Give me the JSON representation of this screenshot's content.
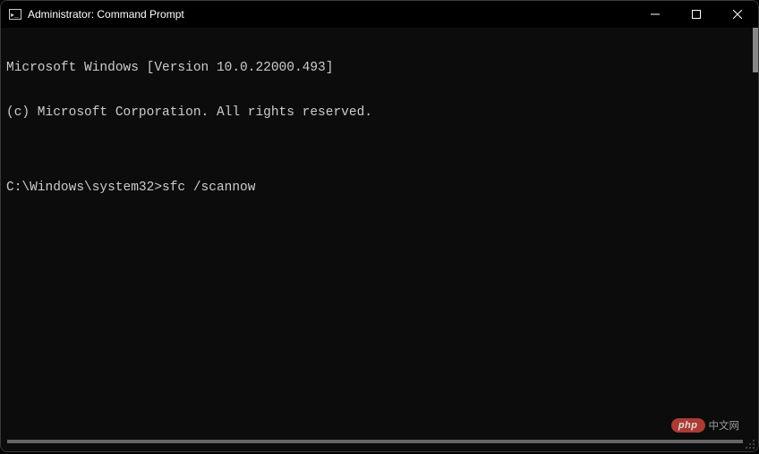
{
  "window": {
    "title": "Administrator: Command Prompt"
  },
  "terminal": {
    "lines": [
      "Microsoft Windows [Version 10.0.22000.493]",
      "(c) Microsoft Corporation. All rights reserved.",
      "",
      "C:\\Windows\\system32>sfc /scannow"
    ],
    "prompt": "C:\\Windows\\system32>",
    "command": "sfc /scannow"
  },
  "watermark": {
    "badge": "php",
    "text": "中文网"
  }
}
